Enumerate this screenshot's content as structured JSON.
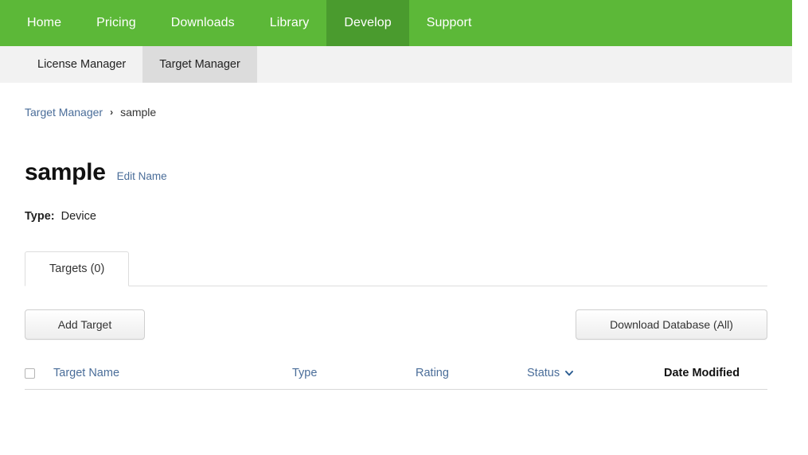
{
  "topnav": {
    "items": [
      {
        "label": "Home",
        "active": false
      },
      {
        "label": "Pricing",
        "active": false
      },
      {
        "label": "Downloads",
        "active": false
      },
      {
        "label": "Library",
        "active": false
      },
      {
        "label": "Develop",
        "active": true
      },
      {
        "label": "Support",
        "active": false
      }
    ],
    "background_color": "#5cb838",
    "active_background_color": "#4a9b2e",
    "text_color": "#ffffff"
  },
  "subnav": {
    "items": [
      {
        "label": "License Manager",
        "active": false
      },
      {
        "label": "Target Manager",
        "active": true
      }
    ],
    "background_color": "#f2f2f2",
    "active_background_color": "#dcdcdc"
  },
  "breadcrumb": {
    "root_label": "Target Manager",
    "separator": "›",
    "current_label": "sample",
    "link_color": "#4a6d99"
  },
  "header": {
    "title": "sample",
    "edit_link": "Edit Name",
    "type_label": "Type:",
    "type_value": "Device"
  },
  "tabs": [
    {
      "label": "Targets (0)",
      "active": true
    }
  ],
  "actions": {
    "add_target": "Add Target",
    "download_database": "Download Database (All)"
  },
  "table": {
    "select_all_checkbox": "",
    "columns": [
      {
        "label": "Target Name",
        "sortable": true,
        "sorted": false,
        "emphasis": "link"
      },
      {
        "label": "Type",
        "sortable": true,
        "sorted": false,
        "emphasis": "link"
      },
      {
        "label": "Rating",
        "sortable": true,
        "sorted": false,
        "emphasis": "link"
      },
      {
        "label": "Status",
        "sortable": true,
        "sorted": true,
        "sort_icon": "chevron-down-icon",
        "emphasis": "link"
      },
      {
        "label": "Date Modified",
        "sortable": false,
        "sorted": false,
        "emphasis": "bold"
      }
    ],
    "rows": [],
    "empty": true
  }
}
